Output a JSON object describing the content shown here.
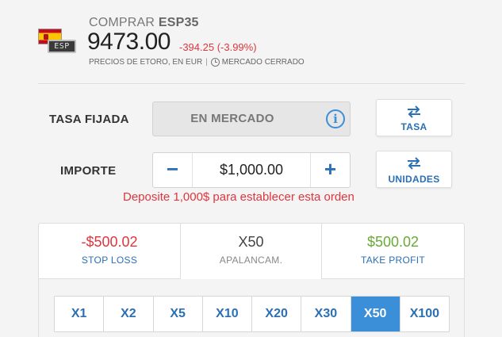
{
  "header": {
    "action": "COMPRAR",
    "symbol": "ESP35",
    "flag_tag": "ESP",
    "price": "9473.00",
    "change": "-394.25 (-3.99%)",
    "prices_note": "PRECIOS DE ETORO, EN EUR",
    "separator": "|",
    "market_status": "MERCADO CERRADO"
  },
  "rate": {
    "label": "TASA FIJADA",
    "value": "EN MERCADO",
    "info_glyph": "i",
    "toggle_label": "TASA"
  },
  "amount": {
    "label": "IMPORTE",
    "value": "$1,000.00",
    "minus": "−",
    "plus": "+",
    "toggle_label": "UNIDADES",
    "warning": "Deposite 1,000$ para establecer esta orden"
  },
  "risk": {
    "stop_loss": {
      "value": "-$500.02",
      "label": "STOP LOSS"
    },
    "leverage": {
      "value": "X50",
      "label": "APALANCAM."
    },
    "take_profit": {
      "value": "$500.02",
      "label": "TAKE PROFIT"
    }
  },
  "leverage_options": [
    "X1",
    "X2",
    "X5",
    "X10",
    "X20",
    "X30",
    "X50",
    "X100"
  ],
  "selected_leverage": "X50",
  "colors": {
    "accent": "#2b6fb5",
    "active": "#3b8fd9",
    "negative": "#e0353d",
    "positive": "#6aa935"
  },
  "icons": {
    "flag": "spain-flag-icon",
    "clock": "clock-icon",
    "info": "info-icon",
    "swap": "swap-arrows-icon"
  }
}
